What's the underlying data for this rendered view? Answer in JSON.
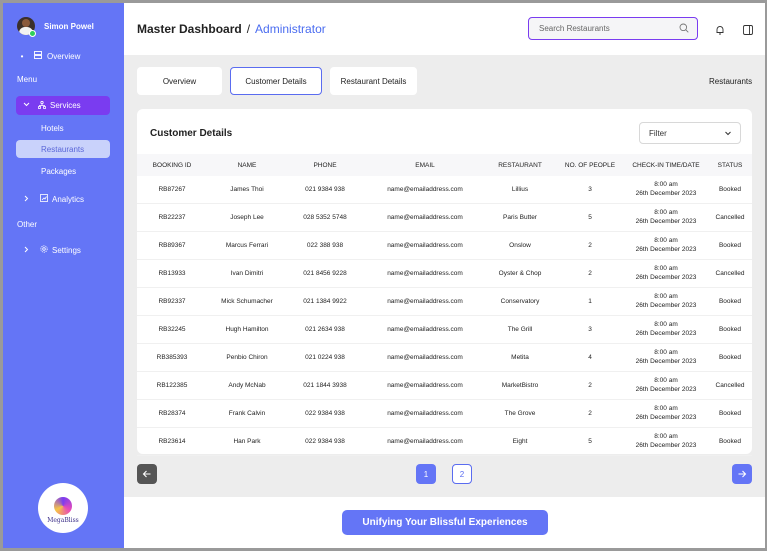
{
  "user": {
    "name": "Simon Powel"
  },
  "sidebar": {
    "overview": "Overview",
    "menu_heading": "Menu",
    "services": "Services",
    "sub_items": [
      "Hotels",
      "Restaurants",
      "Packages"
    ],
    "analytics": "Analytics",
    "other_heading": "Other",
    "settings": "Settings",
    "logo_text": "MegaBliss"
  },
  "header": {
    "title": "Master Dashboard",
    "separator": "/",
    "role": "Administrator",
    "search_placeholder": "Search Restaurants"
  },
  "tabs": [
    "Overview",
    "Customer Details",
    "Restaurant Details"
  ],
  "restaurants_link": "Restaurants",
  "card": {
    "title": "Customer Details",
    "filter_label": "Filter"
  },
  "table": {
    "columns": [
      "BOOKING ID",
      "NAME",
      "PHONE",
      "EMAIL",
      "RESTAURANT",
      "NO. OF PEOPLE",
      "CHECK-IN TIME/DATE",
      "STATUS"
    ],
    "rows": [
      {
        "id": "RB87267",
        "name": "James Thoi",
        "phone": "021 9384 938",
        "email": "name@emailaddress.com",
        "restaurant": "Lillius",
        "people": "3",
        "time": "8:00 am",
        "date": "26th December 2023",
        "status": "Booked"
      },
      {
        "id": "RB22237",
        "name": "Joseph Lee",
        "phone": "028 5352 5748",
        "email": "name@emailaddress.com",
        "restaurant": "Paris Butter",
        "people": "5",
        "time": "8:00 am",
        "date": "26th December 2023",
        "status": "Cancelled"
      },
      {
        "id": "RB89367",
        "name": "Marcus Ferrari",
        "phone": "022 388 938",
        "email": "name@emailaddress.com",
        "restaurant": "Onslow",
        "people": "2",
        "time": "8:00 am",
        "date": "26th December 2023",
        "status": "Booked"
      },
      {
        "id": "RB13933",
        "name": "Ivan Dimitri",
        "phone": "021 8456 9228",
        "email": "name@emailaddress.com",
        "restaurant": "Oyster & Chop",
        "people": "2",
        "time": "8:00 am",
        "date": "26th December 2023",
        "status": "Cancelled"
      },
      {
        "id": "RB92337",
        "name": "Mick Schumacher",
        "phone": "021 1384 9922",
        "email": "name@emailaddress.com",
        "restaurant": "Conservatory",
        "people": "1",
        "time": "8:00 am",
        "date": "26th December 2023",
        "status": "Booked"
      },
      {
        "id": "RB32245",
        "name": "Hugh Hamilton",
        "phone": "021 2634 938",
        "email": "name@emailaddress.com",
        "restaurant": "The Grill",
        "people": "3",
        "time": "8:00 am",
        "date": "26th December 2023",
        "status": "Booked"
      },
      {
        "id": "RB385393",
        "name": "Penbio Chiron",
        "phone": "021 0224 938",
        "email": "name@emailaddress.com",
        "restaurant": "Metita",
        "people": "4",
        "time": "8:00 am",
        "date": "26th December 2023",
        "status": "Booked"
      },
      {
        "id": "RB122385",
        "name": "Andy McNab",
        "phone": "021 1844 3938",
        "email": "name@emailaddress.com",
        "restaurant": "MarketBistro",
        "people": "2",
        "time": "8:00 am",
        "date": "26th December 2023",
        "status": "Cancelled"
      },
      {
        "id": "RB28374",
        "name": "Frank Calvin",
        "phone": "022 9384 938",
        "email": "name@emailaddress.com",
        "restaurant": "The Grove",
        "people": "2",
        "time": "8:00 am",
        "date": "26th December 2023",
        "status": "Booked"
      },
      {
        "id": "RB23614",
        "name": "Han Park",
        "phone": "022 9384 938",
        "email": "name@emailaddress.com",
        "restaurant": "Eight",
        "people": "5",
        "time": "8:00 am",
        "date": "26th December 2023",
        "status": "Booked"
      }
    ]
  },
  "pagination": {
    "pages": [
      "1",
      "2"
    ],
    "current": "1"
  },
  "footer": {
    "cta": "Unifying Your Blissful Experiences"
  },
  "colors": {
    "sidebar": "#6475f6",
    "accent": "#7a3cf0",
    "link": "#4a6cf0",
    "page_btn": "#6475f6"
  }
}
